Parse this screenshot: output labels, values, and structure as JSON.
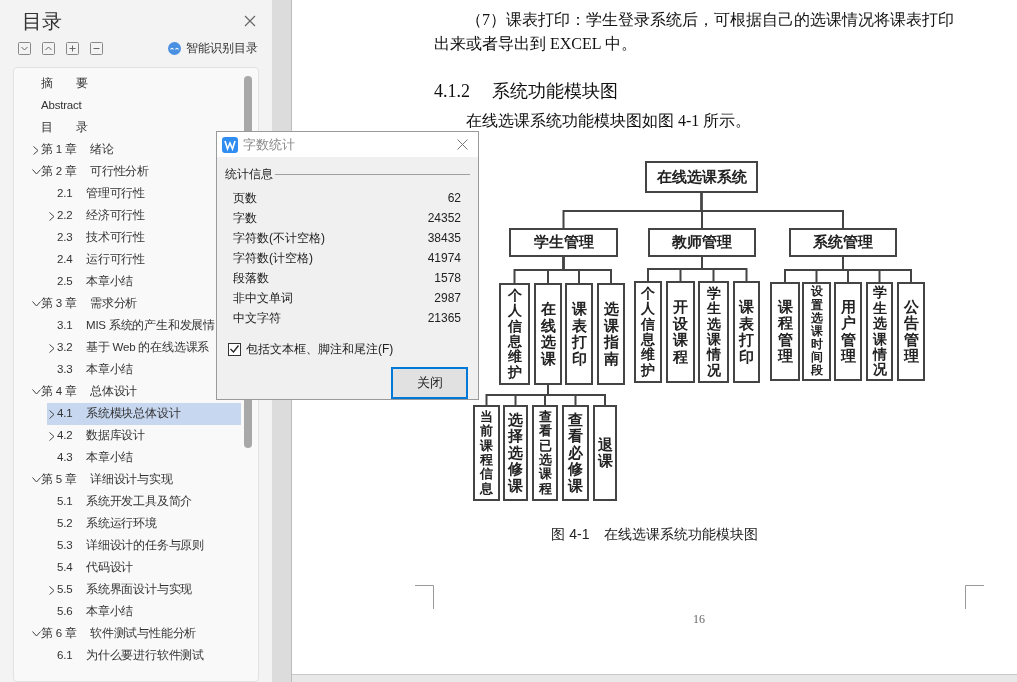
{
  "sidebar": {
    "title": "目录",
    "smart_button": "智能识别目录",
    "items": [
      {
        "label": "摘　　要",
        "selected": false
      },
      {
        "label": "Abstract",
        "selected": false
      },
      {
        "label": "目　　录",
        "selected": false
      },
      {
        "number": "第 1 章",
        "title": "绪论",
        "expanded": false,
        "selected": false
      },
      {
        "number": "第 2 章",
        "title": "可行性分析",
        "expanded": true,
        "selected": false,
        "children": [
          {
            "number": "2.1",
            "title": "管理可行性",
            "selected": false
          },
          {
            "number": "2.2",
            "title": "经济可行性",
            "expanded": false,
            "selected": false
          },
          {
            "number": "2.3",
            "title": "技术可行性",
            "selected": false
          },
          {
            "number": "2.4",
            "title": "运行可行性",
            "selected": false
          },
          {
            "number": "2.5",
            "title": "本章小结",
            "selected": false
          }
        ]
      },
      {
        "number": "第 3 章",
        "title": "需求分析",
        "expanded": true,
        "selected": false,
        "children": [
          {
            "number": "3.1",
            "title": "MIS 系统的产生和发展情",
            "selected": false
          },
          {
            "number": "3.2",
            "title": "基于 Web 的在线选课系",
            "expanded": false,
            "selected": false
          },
          {
            "number": "3.3",
            "title": "本章小结",
            "selected": false
          }
        ]
      },
      {
        "number": "第 4 章",
        "title": "总体设计",
        "expanded": true,
        "selected": false,
        "children": [
          {
            "number": "4.1",
            "title": "系统模块总体设计",
            "expanded": false,
            "selected": true
          },
          {
            "number": "4.2",
            "title": "数据库设计",
            "expanded": false,
            "selected": false
          },
          {
            "number": "4.3",
            "title": "本章小结",
            "selected": false
          }
        ]
      },
      {
        "number": "第 5 章",
        "title": "详细设计与实现",
        "expanded": true,
        "selected": false,
        "children": [
          {
            "number": "5.1",
            "title": "系统开发工具及简介",
            "selected": false
          },
          {
            "number": "5.2",
            "title": "系统运行环境",
            "selected": false
          },
          {
            "number": "5.3",
            "title": "详细设计的任务与原则",
            "selected": false
          },
          {
            "number": "5.4",
            "title": "代码设计",
            "selected": false
          },
          {
            "number": "5.5",
            "title": "系统界面设计与实现",
            "expanded": false,
            "selected": false
          },
          {
            "number": "5.6",
            "title": "本章小结",
            "selected": false
          }
        ]
      },
      {
        "number": "第 6 章",
        "title": "软件测试与性能分析",
        "expanded": true,
        "selected": false,
        "children": [
          {
            "number": "6.1",
            "title": "为什么要进行软件测试",
            "selected": false
          }
        ]
      }
    ]
  },
  "document": {
    "paragraph": "（7）课表打印：学生登录系统后，可根据自己的选课情况将课表打印出来或者导出到 EXCEL 中。",
    "heading_number": "4.1.2",
    "heading": "系统功能模块图",
    "intro": "在线选课系统功能模块图如图 4-1 所示。",
    "diagram": {
      "label": "在线选课系统",
      "children": [
        {
          "label": "学生管理",
          "children": [
            {
              "label": "个人信息维护"
            },
            {
              "label": "在线选课",
              "children": [
                {
                  "label": "当前课程信息"
                },
                {
                  "label": "选择选修课"
                },
                {
                  "label": "查看已选课程"
                },
                {
                  "label": "查看必修课"
                },
                {
                  "label": "退课"
                }
              ]
            },
            {
              "label": "课表打印"
            },
            {
              "label": "选课指南"
            }
          ]
        },
        {
          "label": "教师管理",
          "children": [
            {
              "label": "个人信息维护"
            },
            {
              "label": "开设课程"
            },
            {
              "label": "学生选课情况"
            },
            {
              "label": "课表打印"
            }
          ]
        },
        {
          "label": "系统管理",
          "children": [
            {
              "label": "课程管理"
            },
            {
              "label": "设置选课时间段"
            },
            {
              "label": "用户管理"
            },
            {
              "label": "学生选课情况"
            },
            {
              "label": "公告管理"
            }
          ]
        }
      ]
    },
    "caption": "图 4-1　在线选课系统功能模块图",
    "page_number": "16"
  },
  "word_count_dialog": {
    "title": "字数统计",
    "section": "统计信息",
    "stats": [
      {
        "label": "页数",
        "value": "62"
      },
      {
        "label": "字数",
        "value": "24352"
      },
      {
        "label": "字符数(不计空格)",
        "value": "38435"
      },
      {
        "label": "字符数(计空格)",
        "value": "41974"
      },
      {
        "label": "段落数",
        "value": "1578"
      },
      {
        "label": "非中文单词",
        "value": "2987"
      },
      {
        "label": "中文字符",
        "value": "21365"
      }
    ],
    "include_option": {
      "label": "包括文本框、脚注和尾注(F)",
      "checked": true
    },
    "close_button": "关闭"
  }
}
